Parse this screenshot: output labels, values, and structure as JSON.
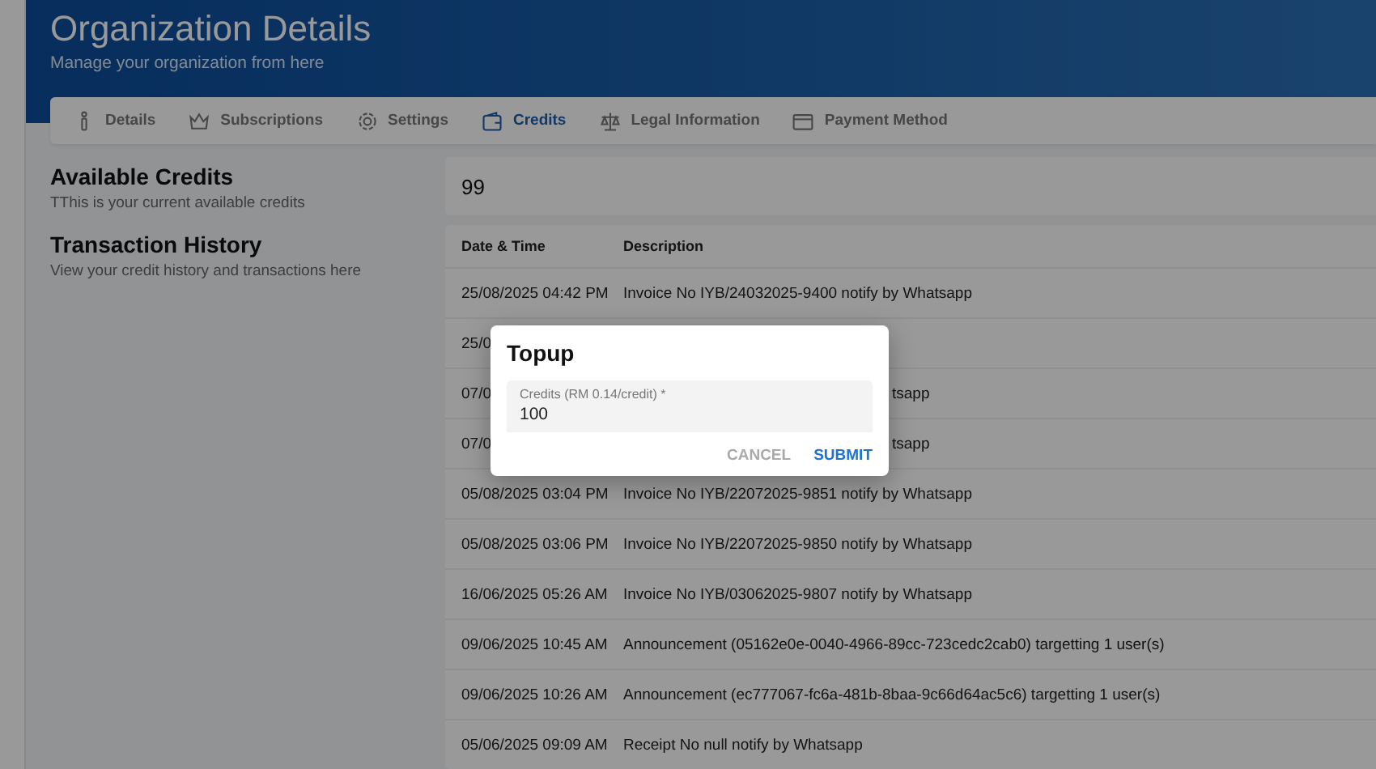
{
  "header": {
    "title": "Organization Details",
    "subtitle": "Manage your organization from here"
  },
  "tabs": [
    {
      "label": "Details",
      "selected": false
    },
    {
      "label": "Subscriptions",
      "selected": false
    },
    {
      "label": "Settings",
      "selected": false
    },
    {
      "label": "Credits",
      "selected": true
    },
    {
      "label": "Legal Information",
      "selected": false
    },
    {
      "label": "Payment Method",
      "selected": false
    }
  ],
  "available_credits": {
    "title": "Available Credits",
    "description": "TThis is your current available credits",
    "value": "99"
  },
  "transaction_history": {
    "title": "Transaction History",
    "description": "View your credit history and transactions here",
    "columns": [
      "Date & Time",
      "Description"
    ],
    "rows": [
      {
        "kind": "full",
        "date_time": "25/08/2025 04:42 PM",
        "description": "Invoice No IYB/24032025-9400 notify by Whatsapp"
      },
      {
        "kind": "covered",
        "date_time": "25/0"
      },
      {
        "kind": "covered",
        "date_time": "07/0",
        "description": "tsapp"
      },
      {
        "kind": "covered",
        "date_time": "07/0",
        "description": "tsapp"
      },
      {
        "kind": "full",
        "date_time": "05/08/2025 03:04 PM",
        "description": "Invoice No IYB/22072025-9851 notify by Whatsapp"
      },
      {
        "kind": "full",
        "date_time": "05/08/2025 03:06 PM",
        "description": "Invoice No IYB/22072025-9850 notify by Whatsapp"
      },
      {
        "kind": "full",
        "date_time": "16/06/2025 05:26 AM",
        "description": "Invoice No IYB/03062025-9807 notify by Whatsapp"
      },
      {
        "kind": "full",
        "date_time": "09/06/2025 10:45 AM",
        "description": "Announcement (05162e0e-0040-4966-89cc-723cedc2cab0) targetting 1 user(s)"
      },
      {
        "kind": "full",
        "date_time": "09/06/2025 10:26 AM",
        "description": "Announcement (ec777067-fc6a-481b-8baa-9c66d64ac5c6) targetting 1 user(s)"
      },
      {
        "kind": "full",
        "date_time": "05/06/2025 09:09 AM",
        "description": "Receipt No null notify by Whatsapp"
      }
    ]
  },
  "dialog": {
    "title": "Topup",
    "field": {
      "label": "Credits (RM 0.14/credit) *",
      "value": "100"
    },
    "buttons": [
      {
        "label": "CANCEL",
        "kind": "secondary"
      },
      {
        "label": "SUBMIT",
        "kind": "primary"
      }
    ]
  }
}
